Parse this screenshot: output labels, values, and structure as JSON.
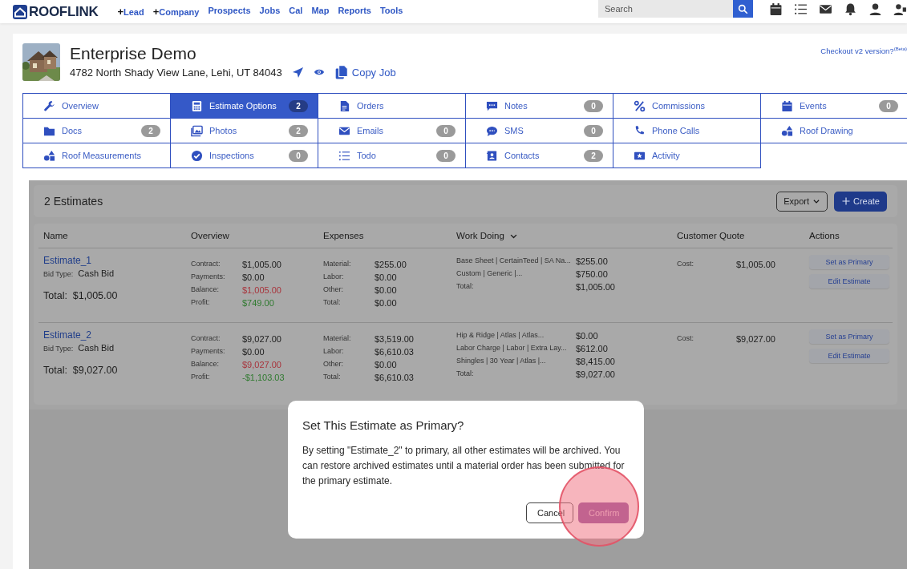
{
  "header": {
    "logo": "ROOFLINK",
    "nav": [
      {
        "prefix": "+",
        "label": "Lead"
      },
      {
        "prefix": "+",
        "label": "Company"
      },
      {
        "label": "Prospects"
      },
      {
        "label": "Jobs"
      },
      {
        "label": "Cal"
      },
      {
        "label": "Map"
      },
      {
        "label": "Reports"
      },
      {
        "label": "Tools"
      }
    ],
    "search": {
      "placeholder": "Search"
    }
  },
  "job": {
    "title": "Enterprise Demo",
    "address": "4782 North Shady View Lane, Lehi, UT 84043",
    "copy_job": "Copy Job",
    "v2_link": "Checkout v2 version?$^{(Beta)}$"
  },
  "tabs": [
    {
      "label": "Overview",
      "selected": false
    },
    {
      "label": "Estimate Options",
      "badge": "2",
      "selected": true
    },
    {
      "label": "Orders",
      "selected": false
    },
    {
      "label": "Notes",
      "badge": "0",
      "selected": false
    },
    {
      "label": "Commissions",
      "selected": false
    },
    {
      "label": "Events",
      "badge": "0",
      "selected": false
    },
    {
      "label": "Docs",
      "badge": "2",
      "selected": false
    },
    {
      "label": "Photos",
      "badge": "2",
      "selected": false
    },
    {
      "label": "Emails",
      "badge": "0",
      "selected": false
    },
    {
      "label": "SMS",
      "badge": "0",
      "selected": false
    },
    {
      "label": "Phone Calls",
      "selected": false
    },
    {
      "label": "Roof Drawing",
      "selected": false
    },
    {
      "label": "Roof Measurements",
      "selected": false
    },
    {
      "label": "Inspections",
      "badge": "0",
      "selected": false
    },
    {
      "label": "Todo",
      "badge": "0",
      "selected": false
    },
    {
      "label": "Contacts",
      "badge": "2",
      "selected": false
    },
    {
      "label": "Activity",
      "selected": false
    }
  ],
  "estimates": {
    "count": "2 Estimates",
    "export": "Export",
    "create": "Create",
    "columns": [
      "Name",
      "Overview",
      "Expenses",
      "Work Doing",
      "Customer Quote",
      "Actions"
    ],
    "rows": [
      {
        "name": "Estimate_1",
        "bid_type_label": "Bid Type:",
        "bid_type": "Cash Bid",
        "total_label": "Total:",
        "total": "$1,005.00",
        "overview": [
          {
            "label": "Contract:",
            "value": "$1,005.00"
          },
          {
            "label": "Payments:",
            "value": "$0.00"
          },
          {
            "label": "Balance:",
            "value": "$1,005.00",
            "color": "#a8343c"
          },
          {
            "label": "Profit:",
            "value": "$749.00",
            "color": "#2f7a2f"
          }
        ],
        "expenses": [
          {
            "label": "Material:",
            "value": "$255.00"
          },
          {
            "label": "Labor:",
            "value": "$0.00"
          },
          {
            "label": "Other:",
            "value": "$0.00"
          },
          {
            "label": "Total:",
            "value": "$0.00"
          }
        ],
        "work": [
          {
            "label": "Base Sheet | CertainTeed | SA Na...",
            "value": "$255.00"
          },
          {
            "label": "Custom | Generic |...",
            "value": "$750.00"
          },
          {
            "label": "Total:",
            "value": "$1,005.00"
          }
        ],
        "quote": {
          "label": "Cost:",
          "value": "$1,005.00"
        },
        "actions": [
          "Set as Primary",
          "Edit Estimate"
        ]
      },
      {
        "name": "Estimate_2",
        "bid_type_label": "Bid Type:",
        "bid_type": "Cash Bid",
        "total_label": "Total:",
        "total": "$9,027.00",
        "overview": [
          {
            "label": "Contract:",
            "value": "$9,027.00"
          },
          {
            "label": "Payments:",
            "value": "$0.00"
          },
          {
            "label": "Balance:",
            "value": "$9,027.00",
            "color": "#a8343c"
          },
          {
            "label": "Profit:",
            "value": "-$1,103.03",
            "color": "#2f7a2f"
          }
        ],
        "expenses": [
          {
            "label": "Material:",
            "value": "$3,519.00"
          },
          {
            "label": "Labor:",
            "value": "$6,610.03"
          },
          {
            "label": "Other:",
            "value": "$0.00"
          },
          {
            "label": "Total:",
            "value": "$6,610.03"
          }
        ],
        "work": [
          {
            "label": "Hip & Ridge | Atlas | Atlas...",
            "value": "$0.00"
          },
          {
            "label": "Labor Charge | Labor | Extra Lay...",
            "value": "$612.00"
          },
          {
            "label": "Shingles | 30 Year | Atlas |...",
            "value": "$8,415.00"
          },
          {
            "label": "Total:",
            "value": "$9,027.00"
          }
        ],
        "quote": {
          "label": "Cost:",
          "value": "$9,027.00"
        },
        "actions": [
          "Set as Primary",
          "Edit Estimate"
        ]
      }
    ]
  },
  "dialog": {
    "title": "Set This Estimate as Primary?",
    "body": "By setting \"Estimate_2\" to primary, all other estimates will be archived. You can restore archived estimates until a material order has been submitted for the primary estimate.",
    "buttons": [
      {
        "label": "Cancel",
        "kind": "secondary"
      },
      {
        "label": "Confirm",
        "kind": "primary"
      }
    ]
  }
}
